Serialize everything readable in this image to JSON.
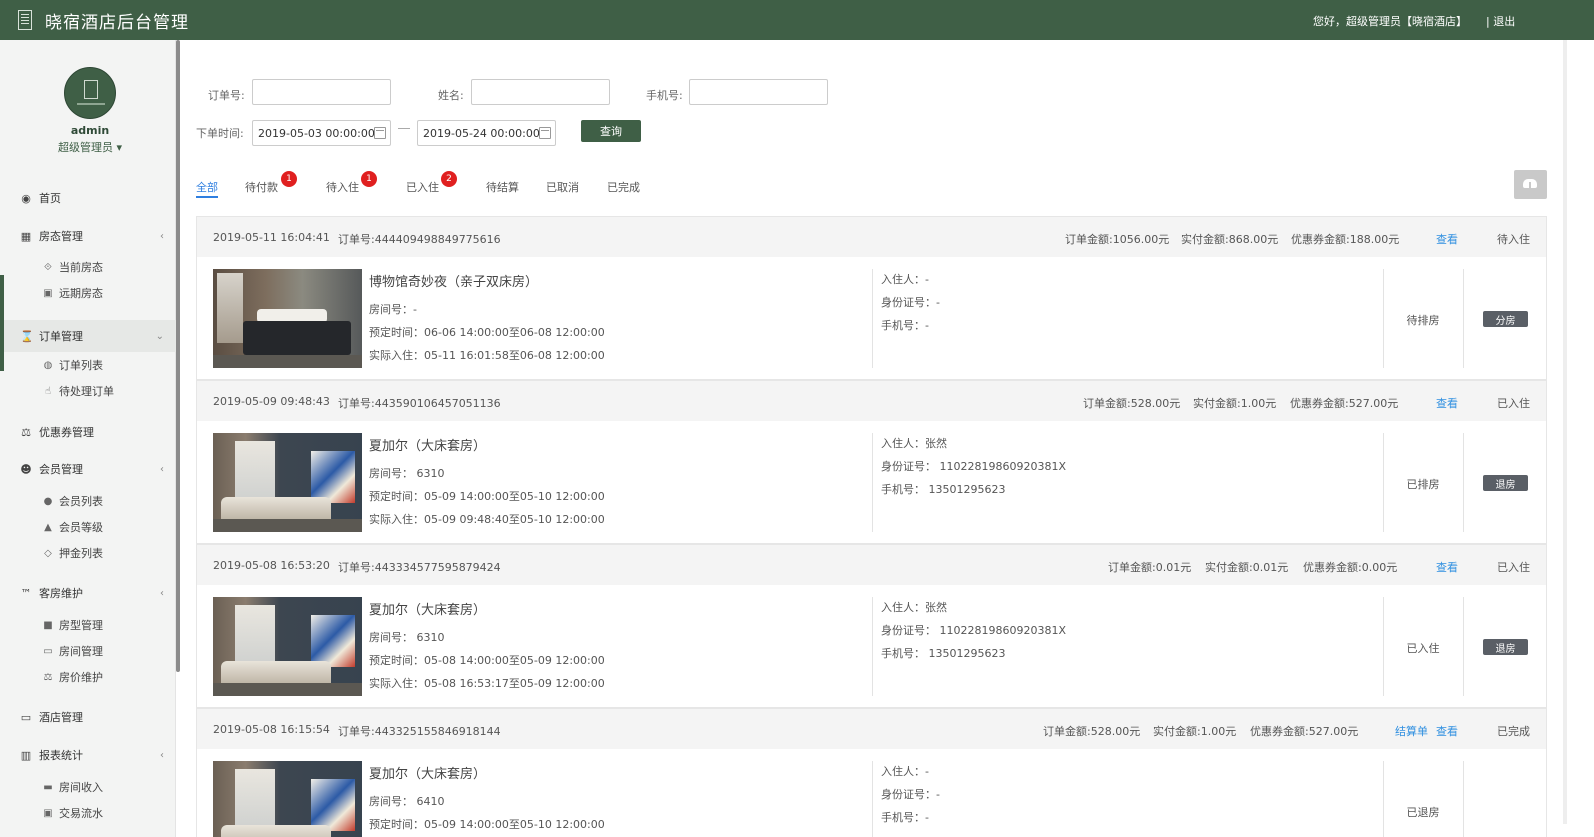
{
  "app": {
    "title": "晓宿酒店后台管理",
    "greeting": "您好，超级管理员【晓宿酒店】",
    "logout": "| 退出"
  },
  "user": {
    "name": "admin",
    "role": "超级管理员 ▾"
  },
  "menu": {
    "home": "首页",
    "room_status": "房态管理",
    "current_status": "当前房态",
    "future_status": "远期房态",
    "orders": "订单管理",
    "order_list": "订单列表",
    "pending_orders": "待处理订单",
    "coupons": "优惠券管理",
    "members": "会员管理",
    "member_list": "会员列表",
    "member_level": "会员等级",
    "deposit_list": "押金列表",
    "room_maint": "客房维护",
    "room_type": "房型管理",
    "room_mgmt": "房间管理",
    "room_price": "房价维护",
    "hotel": "酒店管理",
    "reports": "报表统计",
    "room_income": "房间收入",
    "transactions": "交易流水"
  },
  "filters": {
    "order_no_label": "订单号:",
    "name_label": "姓名:",
    "phone_label": "手机号:",
    "time_label": "下单时间:",
    "date_from": "2019-05-03 00:00:00",
    "date_to": "2019-05-24 00:00:00",
    "query": "查询"
  },
  "tabs": [
    {
      "label": "全部"
    },
    {
      "label": "待付款",
      "badge": "1"
    },
    {
      "label": "待入住",
      "badge": "1"
    },
    {
      "label": "已入住",
      "badge": "2"
    },
    {
      "label": "待结算"
    },
    {
      "label": "已取消"
    },
    {
      "label": "已完成"
    }
  ],
  "orders": [
    {
      "time": "2019-05-11 16:04:41",
      "order_no": "订单号:444409498849775616",
      "amount": "订单金额:1056.00元",
      "paid": "实付金额:868.00元",
      "coupon": "优惠券金额:188.00元",
      "links": [
        "查看"
      ],
      "status": "待入住",
      "room": "博物馆奇妙夜（亲子双床房）",
      "room_no": "房间号：-",
      "booked": "预定时间：06-06 14:00:00至06-08 12:00:00",
      "actual": "实际入住：05-11 16:01:58至06-08 12:00:00",
      "guest": "入住人：-",
      "id_no": "身份证号：-",
      "phone": "手机号：-",
      "room_status": "待排房",
      "action": "分房"
    },
    {
      "time": "2019-05-09 09:48:43",
      "order_no": "订单号:443590106457051136",
      "amount": "订单金额:528.00元",
      "paid": "实付金额:1.00元",
      "coupon": "优惠券金额:527.00元",
      "links": [
        "查看"
      ],
      "status": "已入住",
      "room": "夏加尔（大床套房）",
      "room_no": "房间号： 6310",
      "booked": "预定时间：05-09 14:00:00至05-10 12:00:00",
      "actual": "实际入住：05-09 09:48:40至05-10 12:00:00",
      "guest": "入住人：张然",
      "id_no": "身份证号： 11022819860920381X",
      "phone": "手机号： 13501295623",
      "room_status": "已排房",
      "action": "退房"
    },
    {
      "time": "2019-05-08 16:53:20",
      "order_no": "订单号:443334577595879424",
      "amount": "订单金额:0.01元",
      "paid": "实付金额:0.01元",
      "coupon": "优惠券金额:0.00元",
      "links": [
        "查看"
      ],
      "status": "已入住",
      "room": "夏加尔（大床套房）",
      "room_no": "房间号： 6310",
      "booked": "预定时间：05-08 14:00:00至05-09 12:00:00",
      "actual": "实际入住：05-08 16:53:17至05-09 12:00:00",
      "guest": "入住人：张然",
      "id_no": "身份证号： 11022819860920381X",
      "phone": "手机号： 13501295623",
      "room_status": "已入住",
      "action": "退房"
    },
    {
      "time": "2019-05-08 16:15:54",
      "order_no": "订单号:443325155846918144",
      "amount": "订单金额:528.00元",
      "paid": "实付金额:1.00元",
      "coupon": "优惠券金额:527.00元",
      "links": [
        "结算单",
        "查看"
      ],
      "status": "已完成",
      "room": "夏加尔（大床套房）",
      "room_no": "房间号： 6410",
      "booked": "预定时间：05-09 14:00:00至05-10 12:00:00",
      "actual": "",
      "guest": "入住人：-",
      "id_no": "身份证号：-",
      "phone": "手机号：-",
      "room_status": "已退房",
      "action": ""
    }
  ]
}
